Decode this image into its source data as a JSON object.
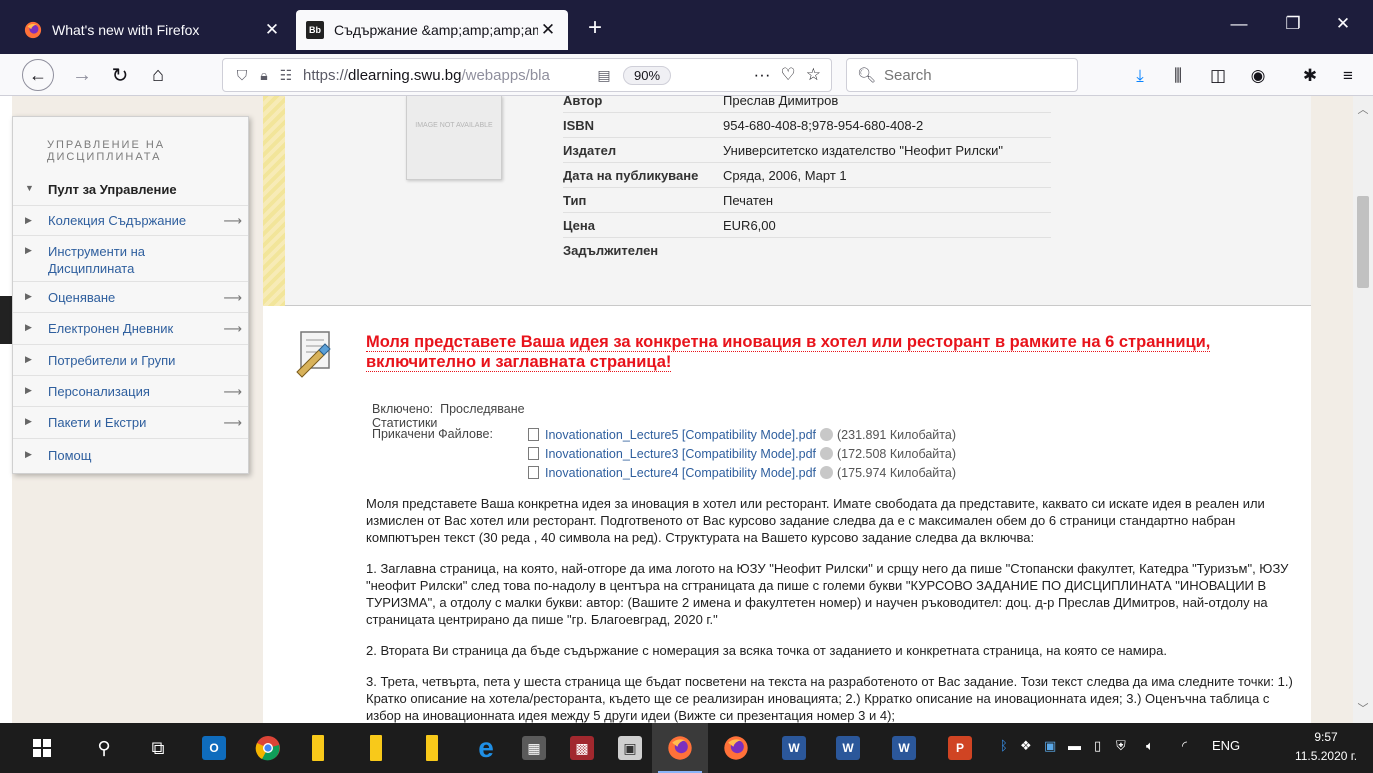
{
  "browser": {
    "tabs": [
      {
        "title": "What's new with Firefox",
        "active": false
      },
      {
        "title": "Съдържание &amp;amp;amp;amp;",
        "active": true
      }
    ],
    "new_tab": "+",
    "url_scheme": "https://",
    "url_host": "dlearning.swu.bg",
    "url_path": "/webapps/bla",
    "zoom": "90%",
    "search_placeholder": "Search",
    "window_controls": {
      "minimize": "—",
      "restore": "❐",
      "close": "✕"
    }
  },
  "sidebar": {
    "heading": "УПРАВЛЕНИЕ НА ДИСЦИПЛИНАТА",
    "section": "Пулт за Управление",
    "items": [
      {
        "label": "Колекция Съдържание",
        "arrow": true
      },
      {
        "label": "Инструменти на Дисциплината",
        "arrow": false
      },
      {
        "label": "Оценяване",
        "arrow": true
      },
      {
        "label": "Електронен Дневник",
        "arrow": true
      },
      {
        "label": "Потребители и Групи",
        "arrow": false
      },
      {
        "label": "Персонализация",
        "arrow": true
      },
      {
        "label": "Пакети и Екстри",
        "arrow": true
      },
      {
        "label": "Помощ",
        "arrow": false
      }
    ]
  },
  "book": {
    "image_text": "IMAGE NOT AVAILABLE",
    "rows": [
      {
        "key": "Автор",
        "value": "Преслав Димитров"
      },
      {
        "key": "ISBN",
        "value": "954-680-408-8;978-954-680-408-2"
      },
      {
        "key": "Издател",
        "value": "Университетско издателство \"Неофит Рилски\""
      },
      {
        "key": "Дата на публикуване",
        "value": "Сряда, 2006, Март 1"
      },
      {
        "key": "Тип",
        "value": "Печатен"
      },
      {
        "key": "Цена",
        "value": "EUR6,00"
      },
      {
        "key": "Задължителен",
        "value": ""
      }
    ]
  },
  "assignment": {
    "title": "Моля представете Ваша идея за конкретна иновация в хотел или ресторант в рамките на 6 стрaнници, включително и заглавната страница!",
    "enabled_label": "Включено:",
    "enabled_value": "Проследяване Статистики",
    "attached_label": "Прикачени Файлове:",
    "files": [
      {
        "name": "Inovationation_Lecture5 [Compatibility Mode].pdf",
        "size": "(231.891 Килобайта)"
      },
      {
        "name": "Inovationation_Lecture3 [Compatibility Mode].pdf",
        "size": "(172.508 Килобайта)"
      },
      {
        "name": "Inovationation_Lecture4 [Compatibility Mode].pdf",
        "size": "(175.974 Килобайта)"
      }
    ],
    "paragraphs": [
      "Моля представете Ваша конкретна идея за иновация в хотел или ресторант. Имате свободата да представите, каквато си искате идея в реален или измислен от Вас хотел или ресторант. Подготвеното от Вас курсово задание следва да е с максимален обем до 6 страници стандартно набран компютърен текст (30 реда , 40 символа на ред). Структурата на Вашето курсово задание следва да включва:",
      "1. Заглавна страница, на която, най-отгоре да има логото на ЮЗУ \"Неофит Рилски\" и срщу него да пише \"Стопански факултет, Катедра \"Туризъм\", ЮЗУ \"неофит Рилски\" след това по-надолу в центъра на сгтраницата да пише с големи букви \"КУРСОВО ЗАДАНИЕ ПО ДИСЦИПЛИНАТА \"ИНОВАЦИИ В ТУРИЗМА\", а отдолу с малки букви: автор: (Вашите 2 имена и факултетен номер) и научен ръководител: доц. д-р Преслав ДИмитров, най-отдолу на страницата центрирано да пише \"гр. Благоевград, 2020 г.\"",
      "2. Втората Ви страница да бъде съдържание с номерация за всяка точка от заданието и конкретната страница, на която се намира.",
      "3. Трета, четвърта, пета у шеста страница ще бъдат посветени на текста на разработеното от Вас задание. Този текст следва да има следните точки: 1.) Кратко описание на хотела/ресторанта, където ще се реализиран иновацията; 2.) Крратко описание на иновационната идея; 3.) Оценъчна таблица с избор на иновационната идея между 5 други идеи (Вижте си презентация номер 3 и 4);"
    ]
  },
  "taskbar": {
    "language": "ENG",
    "time": "9:57",
    "date": "11.5.2020 г."
  },
  "colors": {
    "tabbar": "#1d1d3c",
    "title_red": "#e8131b",
    "link_blue": "#2f5f9e",
    "taskbar": "#1c1c1c"
  }
}
